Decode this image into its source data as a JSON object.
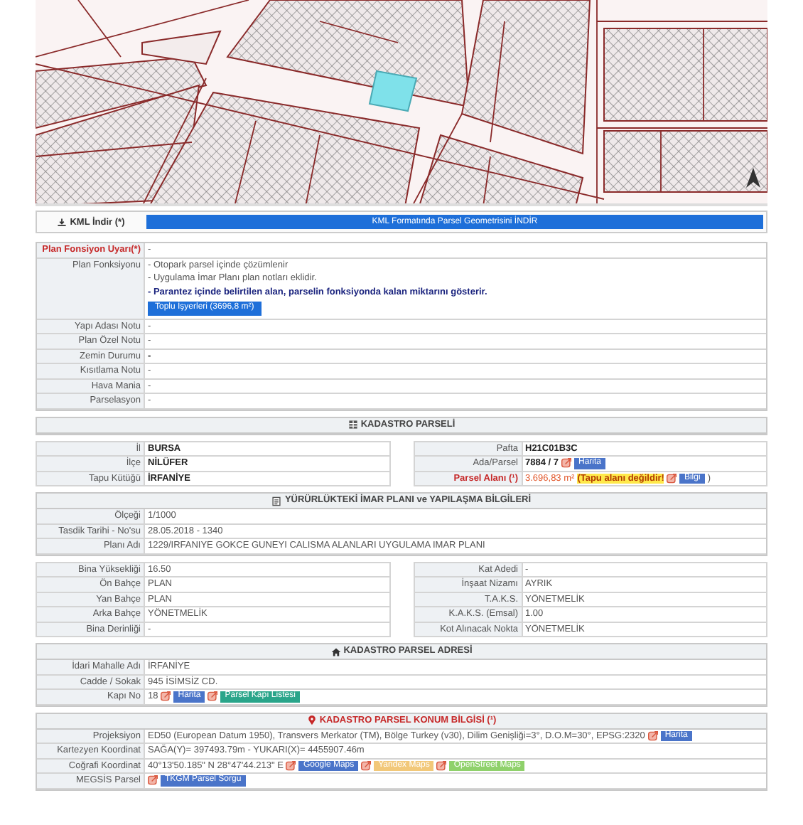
{
  "kml": {
    "label": "KML İndir (*)",
    "button": "KML Formatında Parsel Geometrisini İNDİR"
  },
  "sections": [
    {
      "rows": [
        {
          "label": "Plan Fonsiyon Uyarı(*)",
          "warning": true,
          "parts": [
            {
              "kind": "text",
              "text": "-"
            }
          ]
        },
        {
          "label": "Plan Fonksiyonu",
          "warning": false,
          "parts": [
            {
              "kind": "line",
              "text": "- Otopark parsel içinde çözümlenir"
            },
            {
              "kind": "line",
              "text": "- Uygulama İmar Planı plan notları eklidir."
            },
            {
              "kind": "note",
              "text": "- Parantez içinde belirtilen alan, parselin fonksiyonda kalan miktarını gösterir."
            },
            {
              "kind": "button",
              "text": "Toplu İşyerleri (3696,8 m²)"
            }
          ]
        },
        {
          "label": "Yapı Adası Notu",
          "warning": false,
          "parts": [
            {
              "kind": "text",
              "text": "-"
            }
          ]
        },
        {
          "label": "Plan Özel Notu",
          "warning": false,
          "parts": [
            {
              "kind": "text",
              "text": "-"
            }
          ]
        },
        {
          "label": "Zemin Durumu",
          "warning": false,
          "parts": [
            {
              "kind": "strong",
              "text": "-"
            }
          ]
        },
        {
          "label": "Kısıtlama Notu",
          "warning": false,
          "parts": [
            {
              "kind": "text",
              "text": "-"
            }
          ]
        },
        {
          "label": "Hava Mania",
          "warning": false,
          "parts": [
            {
              "kind": "text",
              "text": "-"
            }
          ]
        },
        {
          "label": "Parselasyon",
          "warning": false,
          "parts": [
            {
              "kind": "text",
              "text": "-"
            }
          ]
        }
      ]
    },
    {
      "kind": "parcel",
      "title": "KADASTRO PARSELİ",
      "pairs": {
        "left": [
          {
            "label": "İl",
            "warning": false,
            "parts": [
              {
                "kind": "strong",
                "text": "BURSA"
              }
            ]
          },
          {
            "label": "İlçe",
            "warning": false,
            "parts": [
              {
                "kind": "strong",
                "text": "NİLÜFER"
              }
            ]
          },
          {
            "label": "Tapu Kütüğü",
            "warning": false,
            "parts": [
              {
                "kind": "strong",
                "text": "İRFANİYE"
              }
            ]
          }
        ],
        "right": [
          {
            "label": "Pafta",
            "warning": false,
            "parts": [
              {
                "kind": "strong",
                "text": "H21C01B3C"
              }
            ]
          },
          {
            "label": "Ada/Parsel",
            "warning": false,
            "parts": [
              {
                "kind": "strong",
                "text": "7884 / 7"
              },
              {
                "kind": "link",
                "text": "Harita",
                "color": "#4a74c9"
              }
            ]
          },
          {
            "label": "Parsel Alanı (¹)",
            "warning": true,
            "parts": [
              {
                "kind": "alert",
                "text": "3.696,83 m²"
              },
              {
                "kind": "highlight",
                "text": "(Tapu alanı değildir!"
              },
              {
                "kind": "link",
                "text": "Bilgi",
                "color": "#4a74c9"
              },
              {
                "kind": "text",
                "text": ")"
              }
            ]
          }
        ]
      }
    },
    {
      "kind": "zoning",
      "title": "YÜRÜRLÜKTEKİ İMAR PLANI ve YAPILAŞMA BİLGİLERİ",
      "rows": [
        {
          "label": "Ölçeği",
          "warning": false,
          "parts": [
            {
              "kind": "text",
              "text": "1/1000"
            }
          ]
        },
        {
          "label": "Tasdik Tarihi - No'su",
          "warning": false,
          "parts": [
            {
              "kind": "text",
              "text": "28.05.2018 - 1340"
            }
          ]
        },
        {
          "label": "Planı Adı",
          "warning": false,
          "parts": [
            {
              "kind": "text",
              "text": "1229/IRFANIYE GOKCE GUNEYI CALISMA ALANLARI UYGULAMA IMAR PLANI"
            }
          ]
        }
      ],
      "pairs": {
        "left": [
          {
            "label": "Bina Yüksekliği",
            "warning": false,
            "parts": [
              {
                "kind": "text",
                "text": "16.50"
              }
            ]
          },
          {
            "label": "Ön Bahçe",
            "warning": false,
            "parts": [
              {
                "kind": "text",
                "text": "PLAN"
              }
            ]
          },
          {
            "label": "Yan Bahçe",
            "warning": false,
            "parts": [
              {
                "kind": "text",
                "text": "PLAN"
              }
            ]
          },
          {
            "label": "Arka Bahçe",
            "warning": false,
            "parts": [
              {
                "kind": "text",
                "text": "YÖNETMELİK"
              }
            ]
          },
          {
            "label": "Bina Derinliği",
            "warning": false,
            "parts": [
              {
                "kind": "text",
                "text": "-"
              }
            ]
          }
        ],
        "right": [
          {
            "label": "Kat Adedi",
            "warning": false,
            "parts": [
              {
                "kind": "text",
                "text": "-"
              }
            ]
          },
          {
            "label": "İnşaat Nizamı",
            "warning": false,
            "parts": [
              {
                "kind": "text",
                "text": "AYRIK"
              }
            ]
          },
          {
            "label": "T.A.K.S.",
            "warning": false,
            "parts": [
              {
                "kind": "text",
                "text": "YÖNETMELİK"
              }
            ]
          },
          {
            "label": "K.A.K.S. (Emsal)",
            "warning": false,
            "parts": [
              {
                "kind": "text",
                "text": "1.00"
              }
            ]
          },
          {
            "label": "Kot Alınacak Nokta",
            "warning": false,
            "parts": [
              {
                "kind": "text",
                "text": "YÖNETMELİK"
              }
            ]
          }
        ]
      }
    },
    {
      "kind": "address",
      "title": "KADASTRO PARSEL ADRESİ",
      "rows": [
        {
          "label": "İdari Mahalle Adı",
          "warning": false,
          "parts": [
            {
              "kind": "text",
              "text": "İRFANİYE"
            }
          ]
        },
        {
          "label": "Cadde / Sokak",
          "warning": false,
          "parts": [
            {
              "kind": "text",
              "text": "945 İSİMSİZ CD."
            }
          ]
        },
        {
          "label": "Kapı No",
          "warning": false,
          "parts": [
            {
              "kind": "text",
              "text": "18"
            },
            {
              "kind": "link",
              "text": "Harita",
              "color": "#4a74c9"
            },
            {
              "kind": "link",
              "text": "Parsel Kapı Listesi",
              "color": "#2aa58a"
            }
          ]
        }
      ]
    },
    {
      "kind": "location",
      "title": "KADASTRO PARSEL KONUM BİLGİSİ (¹)",
      "rows": [
        {
          "label": "Projeksiyon",
          "warning": false,
          "parts": [
            {
              "kind": "text",
              "text": "ED50 (European Datum 1950), Transvers Merkator (TM), Bölge Turkey (v30), Dilim Genişliği=3°, D.O.M=30°, EPSG:2320"
            },
            {
              "kind": "link",
              "text": "Harita",
              "color": "#4a74c9"
            }
          ]
        },
        {
          "label": "Kartezyen Koordinat",
          "warning": false,
          "parts": [
            {
              "kind": "text",
              "text": "SAĞA(Y)= 397493.79m - YUKARI(X)= 4455907.46m"
            }
          ]
        },
        {
          "label": "Coğrafi Koordinat",
          "warning": false,
          "parts": [
            {
              "kind": "text",
              "text": "40°13'50.185\" N 28°47'44.213\" E"
            },
            {
              "kind": "link",
              "text": "Google Maps",
              "color": "#4a74c9"
            },
            {
              "kind": "link",
              "text": "Yandex Maps",
              "color": "#f2c879"
            },
            {
              "kind": "link",
              "text": "OpenStreet Maps",
              "color": "#8fd16b"
            }
          ]
        },
        {
          "label": "MEGSİS Parsel",
          "warning": false,
          "parts": [
            {
              "kind": "link",
              "text": "TKGM Parsel Sorgu",
              "color": "#4a74c9"
            }
          ]
        }
      ]
    }
  ]
}
